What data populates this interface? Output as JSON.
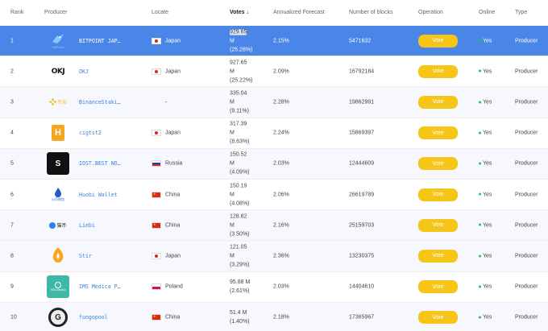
{
  "headers": {
    "rank": "Rank",
    "producer": "Producer",
    "locate": "Locate",
    "votes": "Votes ↓",
    "forecast": "Annualized Forecast",
    "blocks": "Number of blocks",
    "operation": "Operation",
    "online": "Online",
    "type": "Type"
  },
  "rows": [
    {
      "rank": "1",
      "name": "BITPOINT JAP…",
      "logo_text": "BitPoint",
      "logo_icon": "bird-logo-icon",
      "flag": "japan",
      "locate": "Japan",
      "votes_1": "929.65",
      "votes_2": "M",
      "votes_3": "(25.28%)",
      "forecast": "2.15%",
      "blocks": "5471632",
      "action": "Vote",
      "online": "Yes",
      "type": "Producer"
    },
    {
      "rank": "2",
      "name": "OKJ",
      "logo_text": "OKJ",
      "logo_icon": "okj-logo-icon",
      "flag": "japan",
      "locate": "Japan",
      "votes_1": "927.65",
      "votes_2": "M",
      "votes_3": "(25.22%)",
      "forecast": "2.09%",
      "blocks": "16792184",
      "action": "Vote",
      "online": "Yes",
      "type": "Producer"
    },
    {
      "rank": "3",
      "name": "BinanceStaki…",
      "logo_text": "币安",
      "logo_icon": "binance-logo-icon",
      "flag": "",
      "locate": "-",
      "votes_1": "335.04",
      "votes_2": "M",
      "votes_3": "(9.11%)",
      "forecast": "2.28%",
      "blocks": "19862991",
      "action": "Vote",
      "online": "Yes",
      "type": "Producer"
    },
    {
      "rank": "4",
      "name": "cigtst2",
      "logo_text": "H",
      "logo_icon": "cigtst2-logo-icon",
      "flag": "japan",
      "locate": "Japan",
      "votes_1": "317.39",
      "votes_2": "M",
      "votes_3": "(8.63%)",
      "forecast": "2.24%",
      "blocks": "15869397",
      "action": "Vote",
      "online": "Yes",
      "type": "Producer"
    },
    {
      "rank": "5",
      "name": "IOST.BEST NO…",
      "logo_text": "S",
      "logo_icon": "iost-best-logo-icon",
      "flag": "russia",
      "locate": "Russia",
      "votes_1": "150.52",
      "votes_2": "M",
      "votes_3": "(4.09%)",
      "forecast": "2.03%",
      "blocks": "12444609",
      "action": "Vote",
      "online": "Yes",
      "type": "Producer"
    },
    {
      "rank": "6",
      "name": "Huobi Wallet",
      "logo_text": "火币钱包",
      "logo_icon": "huobi-logo-icon",
      "flag": "china",
      "locate": "China",
      "votes_1": "150.19",
      "votes_2": "M",
      "votes_3": "(4.08%)",
      "forecast": "2.06%",
      "blocks": "26619789",
      "action": "Vote",
      "online": "Yes",
      "type": "Producer"
    },
    {
      "rank": "7",
      "name": "Liebi",
      "logo_text": "猫币",
      "logo_icon": "liebi-logo-icon",
      "flag": "china",
      "locate": "China",
      "votes_1": "128.82",
      "votes_2": "M",
      "votes_3": "(3.50%)",
      "forecast": "2.16%",
      "blocks": "25159703",
      "action": "Vote",
      "online": "Yes",
      "type": "Producer"
    },
    {
      "rank": "8",
      "name": "Stir",
      "logo_text": "",
      "logo_icon": "stir-flame-logo-icon",
      "flag": "japan",
      "locate": "Japan",
      "votes_1": "121.05",
      "votes_2": "M",
      "votes_3": "(3.29%)",
      "forecast": "2.36%",
      "blocks": "13230375",
      "action": "Vote",
      "online": "Yes",
      "type": "Producer"
    },
    {
      "rank": "9",
      "name": "IMS Medica P…",
      "logo_text": "IMS Medica",
      "logo_icon": "ims-medica-logo-icon",
      "flag": "poland",
      "locate": "Poland",
      "votes_1": "95.88 M",
      "votes_2": "(2.61%)",
      "votes_3": "",
      "forecast": "2.03%",
      "blocks": "14404610",
      "action": "Vote",
      "online": "Yes",
      "type": "Producer"
    },
    {
      "rank": "10",
      "name": "fungopool",
      "logo_text": "G",
      "logo_icon": "fungopool-logo-icon",
      "flag": "china",
      "locate": "China",
      "votes_1": "51.4 M",
      "votes_2": "(1.40%)",
      "votes_3": "",
      "forecast": "2.18%",
      "blocks": "17365967",
      "action": "Vote",
      "online": "Yes",
      "type": "Producer"
    }
  ],
  "colors": {
    "selected_row": "#4a86e8",
    "vote_button": "#f5c518",
    "link": "#3a84d8",
    "online_dot": "#27c24c"
  }
}
